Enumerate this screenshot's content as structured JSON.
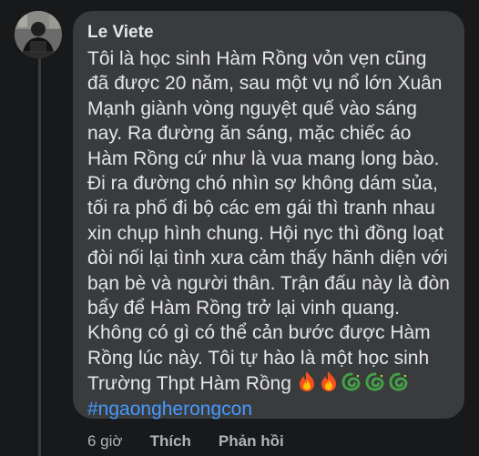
{
  "comment": {
    "author": "Le Viete",
    "lines": [
      "Tôi là học sinh Hàm Rồng vỏn vẹn cũng",
      "đã được 20 năm, sau một vụ nổ lớn Xuân",
      "Mạnh giành vòng nguyệt quế  vào sáng",
      "nay. Ra đường ăn sáng, mặc chiếc áo",
      "Hàm Rồng cứ như là vua mang long bào.",
      "Đi ra đường chó nhìn sợ không dám sủa,",
      "tối ra phố đi bộ các em gái thì tranh nhau",
      "xin chụp hình chung. Hội nyc thì đồng loạt",
      "đòi nối lại tình xưa cảm thấy hãnh diện với",
      "bạn bè và người thân. Trận đấu này là đòn",
      "bẩy để Hàm Rồng trở lại vinh quang.",
      "Không có gì có thể cản bước được Hàm",
      "Rồng lúc này. Tôi tự hào là một học sinh",
      "Trường Thpt Hàm Rồng"
    ],
    "emojis": [
      "fire-icon",
      "fire-icon",
      "dragon-icon",
      "dragon-icon",
      "dragon-icon"
    ],
    "hashtag": "#ngaongherongcon"
  },
  "actions": {
    "time": "6 giờ",
    "like": "Thích",
    "reply": "Phản hồi"
  },
  "colors": {
    "background": "#18191a",
    "bubble": "#3a3b3c",
    "text": "#e4e6eb",
    "secondary_text": "#b0b3b8",
    "hashtag": "#4599ff"
  }
}
